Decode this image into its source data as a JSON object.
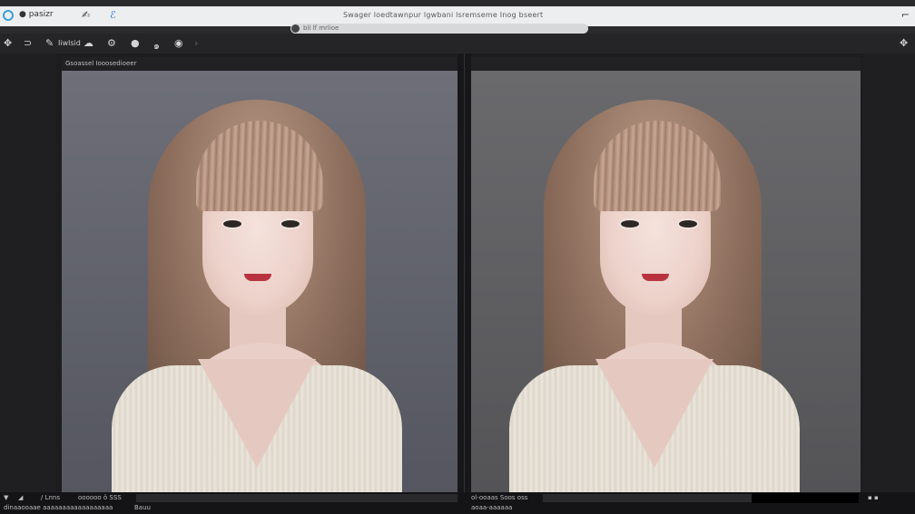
{
  "window": {
    "app_name": "● pasizr",
    "title": "Swager loedtawnpur lgwbani lsremseme Inog bseert",
    "close_glyph": "⌐"
  },
  "pathbar": {
    "text": "bli lf mrlioe"
  },
  "toolbar": {
    "items": [
      {
        "name": "move-tool-icon",
        "glyph": "✥"
      },
      {
        "name": "loop-icon",
        "glyph": "⊃"
      },
      {
        "name": "brush-icon",
        "glyph": "✎"
      },
      {
        "name": "label",
        "text": "Iiwlsid"
      },
      {
        "name": "cloud-icon",
        "glyph": "☁"
      },
      {
        "name": "gear-icon",
        "glyph": "⚙"
      },
      {
        "name": "circle-icon",
        "glyph": "●"
      },
      {
        "name": "swirl-icon",
        "glyph": "๑"
      },
      {
        "name": "drop-icon",
        "glyph": "◉"
      },
      {
        "name": "chevron-right-icon",
        "glyph": "›"
      }
    ],
    "right_icon": "✥"
  },
  "panels": {
    "left_header": "Gsoassel  Iooosedioeer"
  },
  "statusbar": {
    "left_items": [
      "▼",
      "◢",
      "/ Lnns",
      "oooooo  ö  SSS"
    ],
    "left_sub": "dinaaooaae aaaaaaaaaaaaaaaaaa",
    "left_mark": "Bauu",
    "mid_text": "ol-ooaas  Soos  oss",
    "mid_sub": "aoaa-aaaaaa",
    "right_text": "▪ ▪"
  }
}
